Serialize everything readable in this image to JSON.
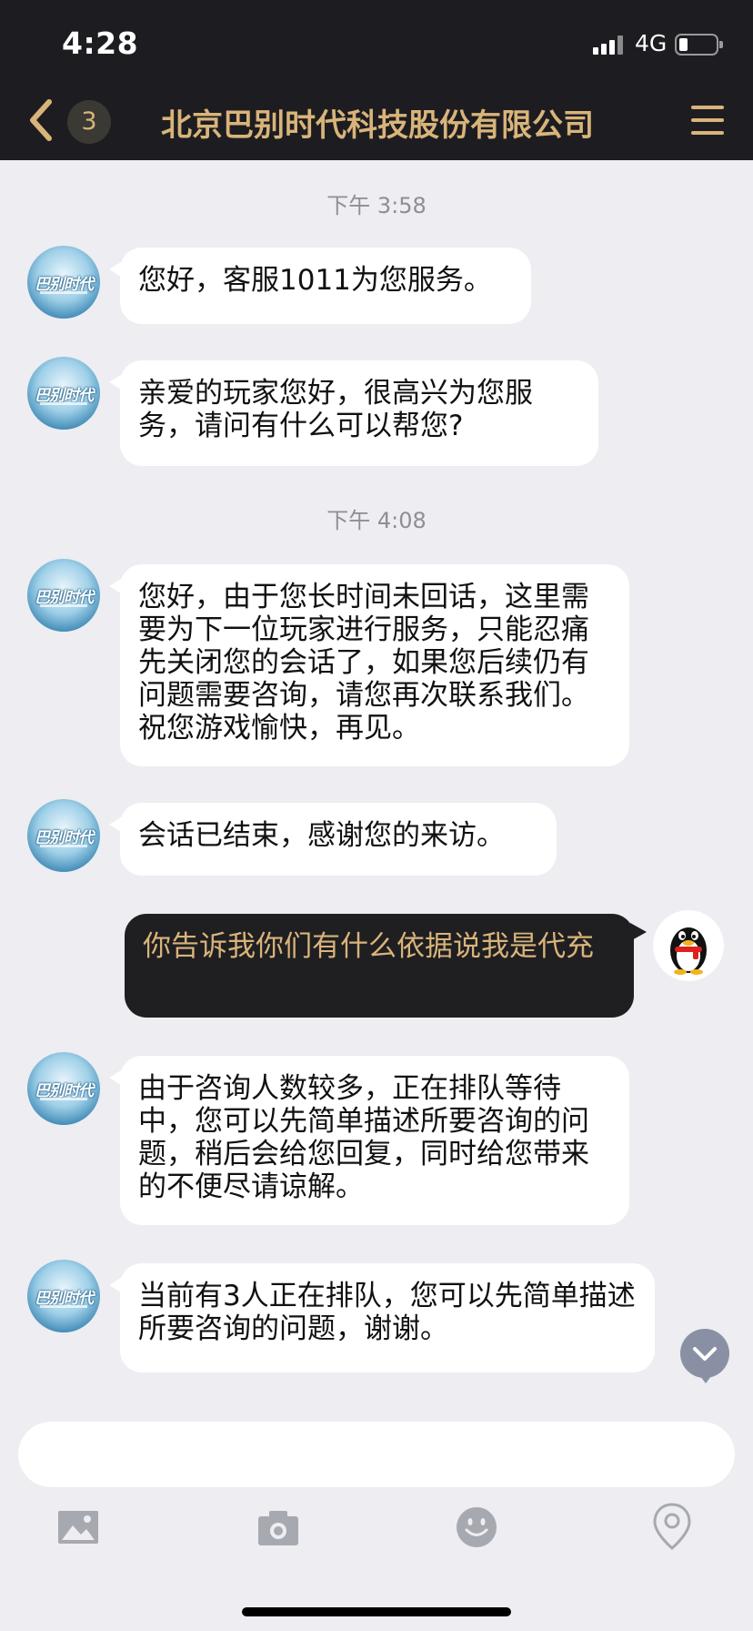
{
  "status": {
    "time": "4:28",
    "network": "4G"
  },
  "nav": {
    "badge": "3",
    "title": "北京巴别时代科技股份有限公司"
  },
  "avatars": {
    "agent_logo": "巴别时代"
  },
  "messages": [
    {
      "time": "下午 3:58"
    },
    {
      "text": "您好，客服1011为您服务。"
    },
    {
      "text": "亲爱的玩家您好，很高兴为您服务，请问有什么可以帮您?"
    },
    {
      "time": "下午 4:08"
    },
    {
      "text": "您好，由于您长时间未回话，这里需要为下一位玩家进行服务，只能忍痛先关闭您的会话了，如果您后续仍有问题需要咨询，请您再次联系我们。祝您游戏愉快，再见。"
    },
    {
      "text": "会话已结束，感谢您的来访。"
    },
    {
      "text": "你告诉我你们有什么依据说我是代充"
    },
    {
      "text": "由于咨询人数较多，正在排队等待中，您可以先简单描述所要咨询的问题，稍后会给您回复，同时给您带来的不便尽请谅解。"
    },
    {
      "text": "当前有3人正在排队，您可以先简单描述所要咨询的问题，谢谢。"
    }
  ],
  "input": {
    "placeholder": ""
  },
  "colors": {
    "dark_bar": "#1d1d21",
    "gold": "#d9b47a",
    "background": "#ededf2",
    "bubble": "#ffffff"
  }
}
